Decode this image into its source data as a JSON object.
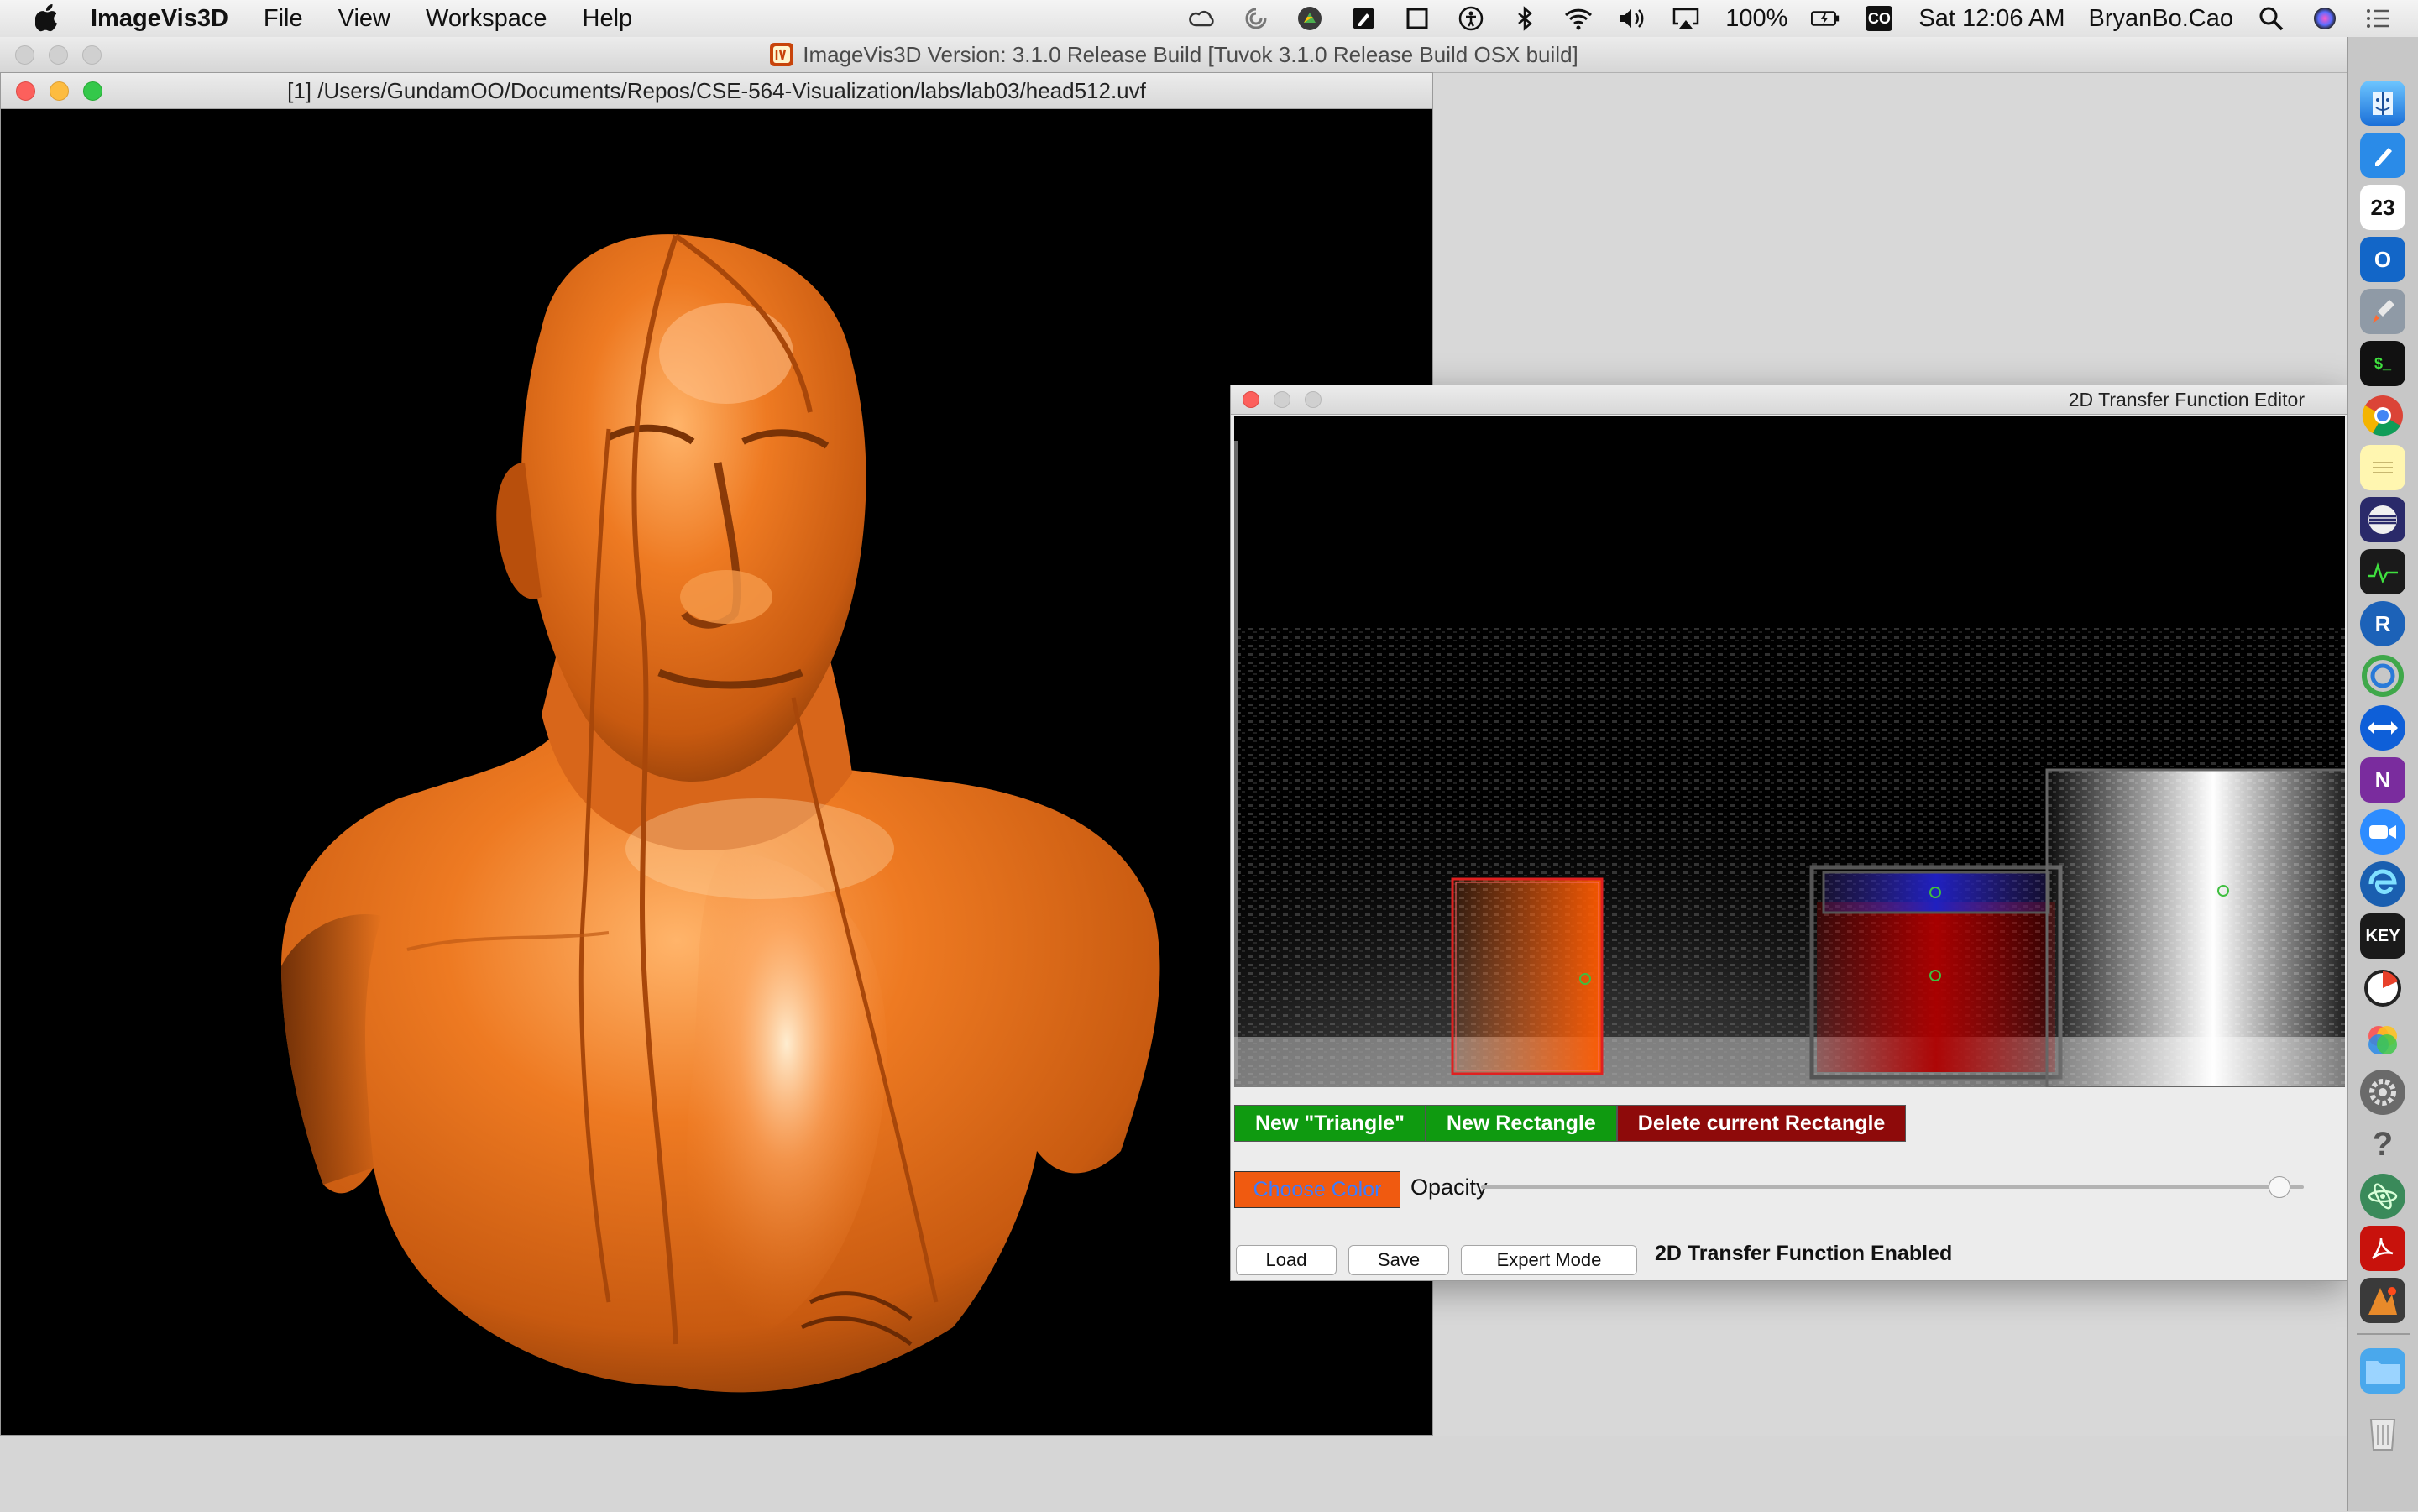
{
  "menubar": {
    "app_name": "ImageVis3D",
    "items": [
      "File",
      "View",
      "Workspace",
      "Help"
    ],
    "battery": "100%",
    "clock": "Sat 12:06 AM",
    "user": "BryanBo.Cao",
    "cc_badge": "CO",
    "status_icons": [
      "creative-cloud-icon",
      "sync-icon",
      "google-drive-icon",
      "notes-icon",
      "window-icon",
      "accessibility-icon",
      "bluetooth-icon",
      "wifi-icon",
      "volume-icon",
      "airplay-icon",
      "battery-icon",
      "search-icon",
      "siri-icon",
      "notification-center-icon"
    ]
  },
  "main_window": {
    "title": "ImageVis3D Version: 3.1.0 Release Build [Tuvok 3.1.0 Release Build OSX build]",
    "app_icon": "imagevis3d-icon"
  },
  "render_window": {
    "title": "[1] /Users/GundamOO/Documents/Repos/CSE-564-Visualization/labs/lab03/head512.uvf",
    "volume_color": "#e8731f"
  },
  "tf_editor": {
    "title": "2D Transfer Function Editor",
    "buttons": {
      "new_triangle": "New \"Triangle\"",
      "new_rectangle": "New Rectangle",
      "delete_rectangle": "Delete current Rectangle",
      "choose_color": "Choose Color",
      "load": "Load",
      "save": "Save",
      "expert_mode": "Expert Mode"
    },
    "opacity_label": "Opacity",
    "opacity_value": 0.97,
    "status": "2D Transfer Function Enabled",
    "colors": {
      "button_green": "#0f9a10",
      "button_darkred": "#8e0a0a",
      "choose_color_bg": "#f05a10",
      "choose_color_text": "#3b7cff"
    }
  },
  "dock": {
    "calendar_day": "23",
    "keynote_label": "KEY",
    "r_label": "R",
    "onenote_label": "N",
    "terminal_label": "$_",
    "icons": [
      "finder-icon",
      "pages-icon",
      "calendar-icon",
      "outlook-icon",
      "launchpad-icon",
      "terminal-icon",
      "chrome-icon",
      "notes-icon",
      "eclipse-icon",
      "activity-monitor-icon",
      "r-icon",
      "anaconda-icon",
      "teamviewer-icon",
      "onenote-icon",
      "zoom-icon",
      "edge-icon",
      "keynote-icon",
      "bowtie-icon",
      "photos-icon",
      "system-preferences-icon",
      "help-icon",
      "atom-icon",
      "acrobat-icon",
      "imagevis3d-icon",
      "folder-icon",
      "trash-icon"
    ]
  }
}
